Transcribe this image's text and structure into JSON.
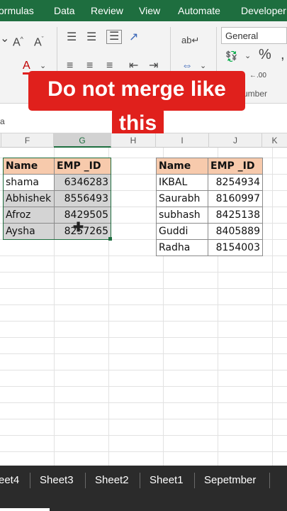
{
  "ribbon_tabs": [
    "ormulas",
    "Data",
    "Review",
    "View",
    "Automate",
    "Developer"
  ],
  "ribbon": {
    "number_format": "General",
    "number_group_label": "umber",
    "icons": [
      "font-grow-icon",
      "font-shrink-icon",
      "align-top-icon",
      "align-middle-icon",
      "wrap-text-icon",
      "font-color-icon",
      "currency-icon",
      "percent-icon"
    ]
  },
  "caption": {
    "line1": "Do not merge like",
    "line2": "this"
  },
  "column_headers": [
    "F",
    "G",
    "H",
    "I",
    "J",
    "K"
  ],
  "table_left": {
    "headers": [
      "Name",
      "EMP _ID"
    ],
    "rows": [
      [
        "shama",
        "6346283"
      ],
      [
        "Abhishek",
        "8556493"
      ],
      [
        "Afroz",
        "8429505"
      ],
      [
        "Aysha",
        "8257265"
      ]
    ]
  },
  "table_right": {
    "headers": [
      "Name",
      "EMP _ID"
    ],
    "rows": [
      [
        "IKBAL",
        "8254934"
      ],
      [
        "Saurabh",
        "8160997"
      ],
      [
        "subhash",
        "8425138"
      ],
      [
        "Guddi",
        "8405889"
      ],
      [
        "Radha",
        "8154003"
      ]
    ]
  },
  "sheet_tabs": [
    "eet4",
    "Sheet3",
    "Sheet2",
    "Sheet1",
    "Sepetmber"
  ],
  "colors": {
    "ribbon_green": "#1e6e3f",
    "header_fill": "#f7caac",
    "caption_red": "#e0201c",
    "selection_gray": "#d4d4d4"
  }
}
